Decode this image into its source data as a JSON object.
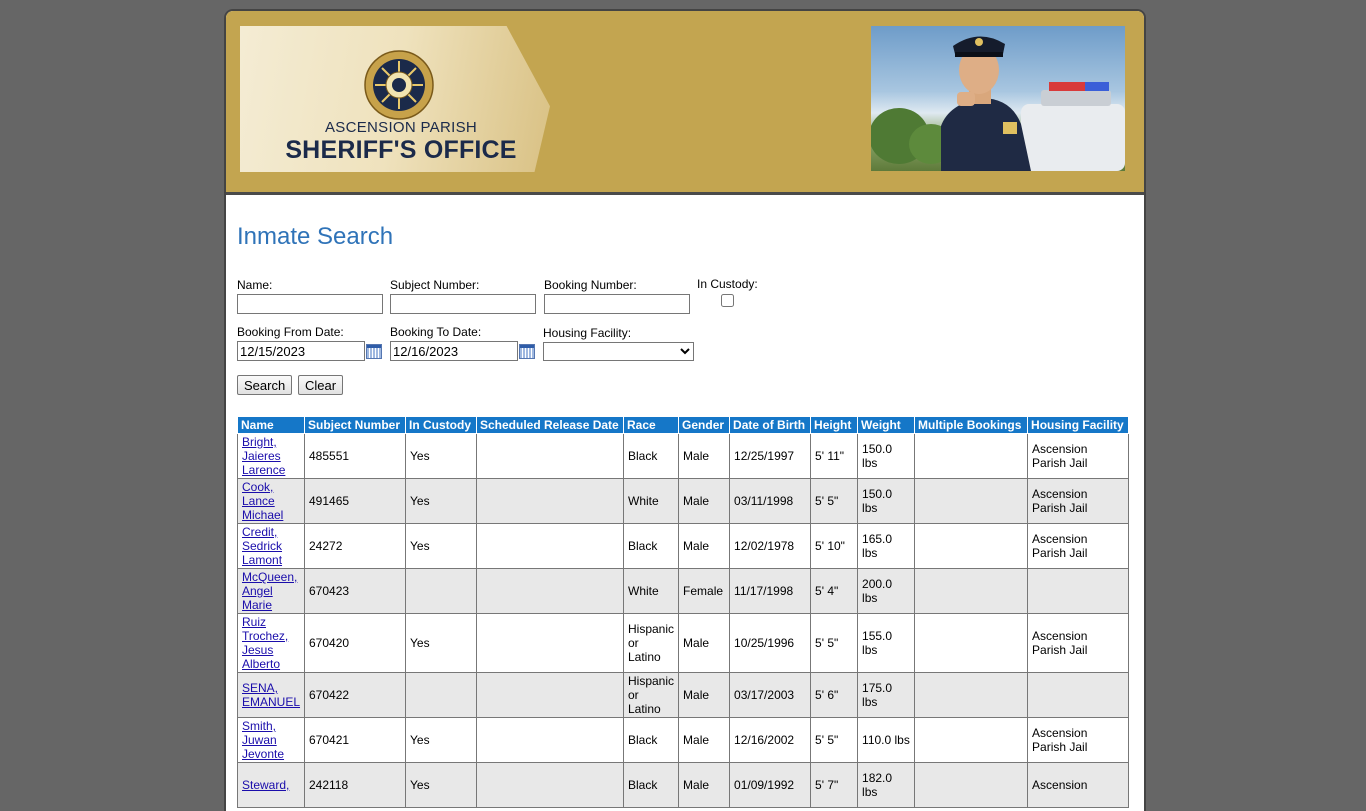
{
  "header": {
    "logo_line1": "ASCENSION PARISH",
    "logo_line2": "SHERIFF'S OFFICE",
    "badge_text": "200TH ANNIVERSARY · LOUISIANA · 1812 2012"
  },
  "page_title": "Inmate Search",
  "form": {
    "name_label": "Name:",
    "name_value": "",
    "subject_label": "Subject Number:",
    "subject_value": "",
    "booking_label": "Booking Number:",
    "booking_value": "",
    "custody_label": "In Custody:",
    "custody_checked": false,
    "from_label": "Booking From Date:",
    "from_value": "12/15/2023",
    "to_label": "Booking To Date:",
    "to_value": "12/16/2023",
    "facility_label": "Housing Facility:",
    "facility_value": "",
    "search_label": "Search",
    "clear_label": "Clear"
  },
  "table": {
    "headers": [
      "Name",
      "Subject Number",
      "In Custody",
      "Scheduled Release Date",
      "Race",
      "Gender",
      "Date of Birth",
      "Height",
      "Weight",
      "Multiple Bookings",
      "Housing Facility"
    ],
    "rows": [
      {
        "name": "Bright, Jaieres Larence",
        "subject": "485551",
        "custody": "Yes",
        "release": "",
        "race": "Black",
        "gender": "Male",
        "dob": "12/25/1997",
        "height": "5' 11\"",
        "weight": "150.0 lbs",
        "multiple": "",
        "facility": "Ascension Parish Jail"
      },
      {
        "name": "Cook, Lance Michael",
        "subject": "491465",
        "custody": "Yes",
        "release": "",
        "race": "White",
        "gender": "Male",
        "dob": "03/11/1998",
        "height": "5' 5\"",
        "weight": "150.0 lbs",
        "multiple": "",
        "facility": "Ascension Parish Jail"
      },
      {
        "name": "Credit, Sedrick Lamont",
        "subject": "24272",
        "custody": "Yes",
        "release": "",
        "race": "Black",
        "gender": "Male",
        "dob": "12/02/1978",
        "height": "5' 10\"",
        "weight": "165.0 lbs",
        "multiple": "",
        "facility": "Ascension Parish Jail"
      },
      {
        "name": "McQueen, Angel Marie",
        "subject": "670423",
        "custody": "",
        "release": "",
        "race": "White",
        "gender": "Female",
        "dob": "11/17/1998",
        "height": "5' 4\"",
        "weight": "200.0 lbs",
        "multiple": "",
        "facility": ""
      },
      {
        "name": "Ruiz Trochez, Jesus Alberto",
        "subject": "670420",
        "custody": "Yes",
        "release": "",
        "race": "Hispanic or Latino",
        "gender": "Male",
        "dob": "10/25/1996",
        "height": "5' 5\"",
        "weight": "155.0 lbs",
        "multiple": "",
        "facility": "Ascension Parish Jail"
      },
      {
        "name": "SENA, EMANUEL",
        "subject": "670422",
        "custody": "",
        "release": "",
        "race": "Hispanic or Latino",
        "gender": "Male",
        "dob": "03/17/2003",
        "height": "5' 6\"",
        "weight": "175.0 lbs",
        "multiple": "",
        "facility": ""
      },
      {
        "name": "Smith, Juwan Jevonte",
        "subject": "670421",
        "custody": "Yes",
        "release": "",
        "race": "Black",
        "gender": "Male",
        "dob": "12/16/2002",
        "height": "5' 5\"",
        "weight": "110.0 lbs",
        "multiple": "",
        "facility": "Ascension Parish Jail"
      },
      {
        "name": "Steward,",
        "subject": "242118",
        "custody": "Yes",
        "release": "",
        "race": "Black",
        "gender": "Male",
        "dob": "01/09/1992",
        "height": "5' 7\"",
        "weight": "182.0 lbs",
        "multiple": "",
        "facility": "Ascension"
      }
    ]
  },
  "colors": {
    "header_gold": "#c3a550",
    "title_blue": "#2f73b8",
    "table_header_blue": "#1577c8",
    "row_alt": "#e8e8e8"
  }
}
